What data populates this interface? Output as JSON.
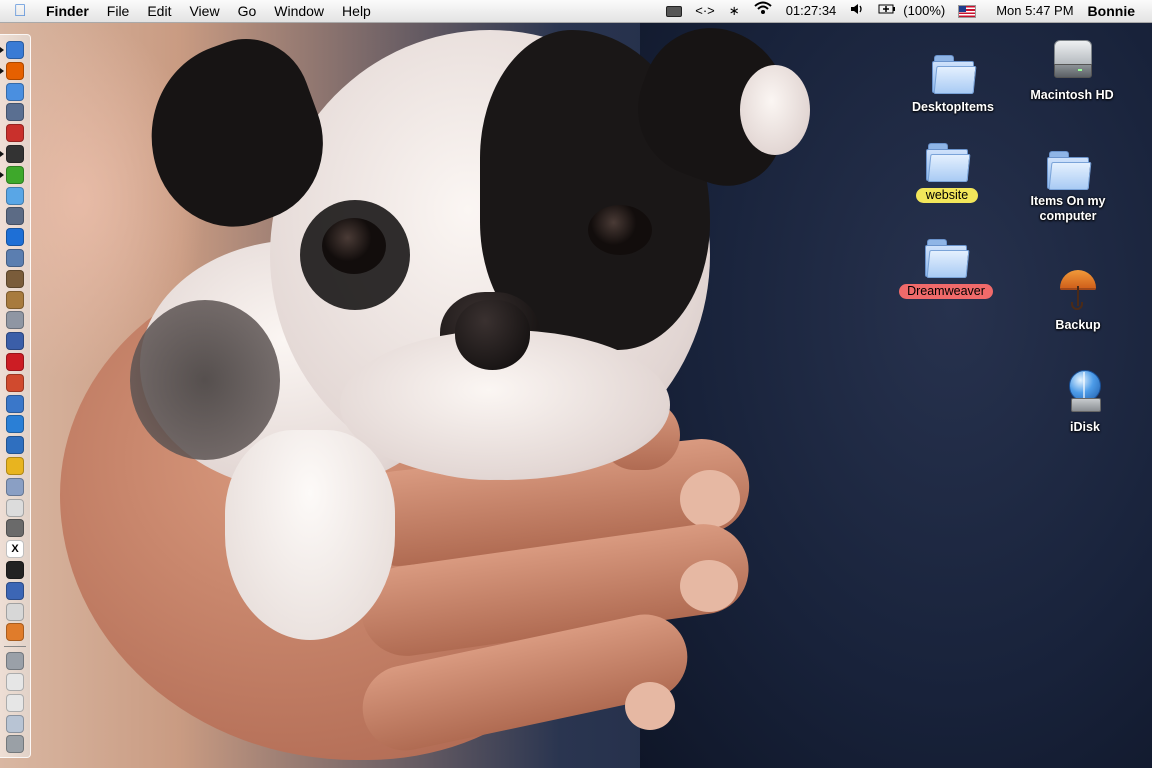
{
  "menubar": {
    "app_name": "Finder",
    "menus": [
      "File",
      "Edit",
      "View",
      "Go",
      "Window",
      "Help"
    ],
    "status": {
      "code_brackets": "<·>",
      "clock": "01:27:34",
      "battery_percent": "(100%)",
      "datetime": "Mon 5:47 PM",
      "user": "Bonnie"
    },
    "icons": [
      "apple-menu-icon",
      "battery-icon",
      "code-icon",
      "bluetooth-icon",
      "wifi-icon",
      "volume-icon",
      "power-icon",
      "flag-icon"
    ]
  },
  "desktop_icons": [
    {
      "name": "DesktopItems",
      "kind": "folder",
      "label_style": "plain"
    },
    {
      "name": "Macintosh HD",
      "kind": "hard-drive",
      "label_style": "plain"
    },
    {
      "name": "website",
      "kind": "folder",
      "label_style": "yellow",
      "label_color": "#f2e65a"
    },
    {
      "name": "Items On my computer",
      "kind": "folder",
      "label_style": "plain"
    },
    {
      "name": "Dreamweaver",
      "kind": "folder",
      "label_style": "red",
      "label_color": "#f06a6a"
    },
    {
      "name": "Backup",
      "kind": "umbrella",
      "label_style": "plain"
    },
    {
      "name": "iDisk",
      "kind": "idisk",
      "label_style": "plain"
    }
  ],
  "dock": {
    "position": "left",
    "items": [
      {
        "icon": "finder-icon",
        "color": "#3a7bd5"
      },
      {
        "icon": "firefox-icon",
        "color": "#e66000"
      },
      {
        "icon": "safari-icon",
        "color": "#4a8fe0"
      },
      {
        "icon": "system-preferences-icon",
        "color": "#5a6f91"
      },
      {
        "icon": "ical-icon",
        "color": "#c9302c"
      },
      {
        "icon": "keyboard-icon",
        "color": "#333333"
      },
      {
        "icon": "itunes-icon",
        "color": "#3ea82b"
      },
      {
        "icon": "itunes-music-icon",
        "color": "#59a6e6"
      },
      {
        "icon": "mail-icon",
        "color": "#5c6b85"
      },
      {
        "icon": "internet-explorer-icon",
        "color": "#1e6fd6"
      },
      {
        "icon": "address-book-icon",
        "color": "#5b7eb0"
      },
      {
        "icon": "iphoto-icon",
        "color": "#7a5c3a"
      },
      {
        "icon": "book-icon",
        "color": "#a87b3e"
      },
      {
        "icon": "apple-icon",
        "color": "#8f96a3"
      },
      {
        "icon": "shield-icon",
        "color": "#3b5ea8"
      },
      {
        "icon": "opera-icon",
        "color": "#cc1d24"
      },
      {
        "icon": "pen-icon",
        "color": "#d04a2e"
      },
      {
        "icon": "eye-icon",
        "color": "#3a77c9"
      },
      {
        "icon": "quicktime-icon",
        "color": "#2a7fd6"
      },
      {
        "icon": "play-icon",
        "color": "#2f6fbf"
      },
      {
        "icon": "wand-icon",
        "color": "#e8b41f"
      },
      {
        "icon": "spray-icon",
        "color": "#8a9fc4"
      },
      {
        "icon": "notepad-icon",
        "color": "#dcdcdc"
      },
      {
        "icon": "camera-icon",
        "color": "#6a6a6a"
      },
      {
        "icon": "x11-icon",
        "color": "#ffffff"
      },
      {
        "icon": "terminal-icon",
        "color": "#222222"
      },
      {
        "icon": "people-icon",
        "color": "#3c66b5"
      },
      {
        "icon": "cards-icon",
        "color": "#d7d7d7"
      },
      {
        "icon": "umbrella-icon",
        "color": "#e07c2b"
      }
    ],
    "lower_items": [
      {
        "icon": "network-icon",
        "color": "#9aa0a8"
      },
      {
        "icon": "document-icon",
        "color": "#e6e6e6"
      },
      {
        "icon": "document-icon",
        "color": "#e6e6e6"
      },
      {
        "icon": "window-icon",
        "color": "#b8c4d4"
      },
      {
        "icon": "trash-icon",
        "color": "#9aa0a6"
      }
    ]
  }
}
